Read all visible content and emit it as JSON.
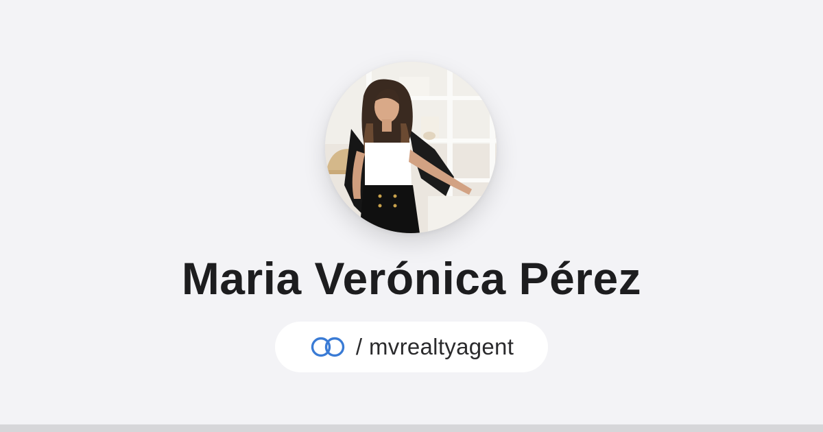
{
  "profile": {
    "name": "Maria Verónica Pérez",
    "separator": "/",
    "handle": "mvrealtyagent"
  },
  "icons": {
    "brand": "linked-rings-icon",
    "avatar": "profile-photo"
  },
  "colors": {
    "background": "#f3f3f6",
    "name_text": "#1d1d1f",
    "pill_background": "#ffffff",
    "brand_blue": "#3a7bd5",
    "bottom_bar": "#d6d6d9"
  }
}
